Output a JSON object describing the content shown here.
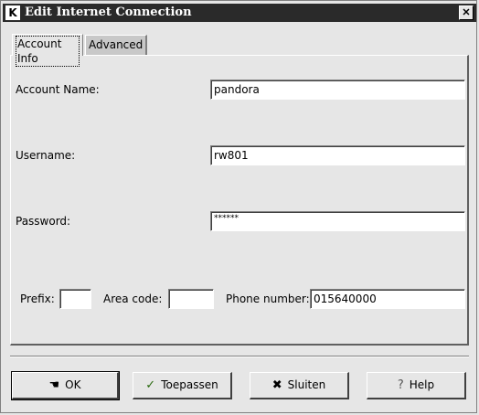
{
  "window": {
    "title": "Edit Internet Connection",
    "logo": "K",
    "close_glyph": "✕"
  },
  "tabs": [
    {
      "label": "Account Info",
      "active": true
    },
    {
      "label": "Advanced",
      "active": false
    }
  ],
  "form": {
    "account_name_label": "Account Name:",
    "account_name_value": "pandora",
    "username_label": "Username:",
    "username_value": "rw801",
    "password_label": "Password:",
    "password_value": "******",
    "prefix_label": "Prefix:",
    "prefix_value": "",
    "area_code_label": "Area code:",
    "area_code_value": "",
    "phone_label": "Phone number:",
    "phone_value": "015640000"
  },
  "buttons": {
    "ok": {
      "label": "OK",
      "icon": "hand-pointer-icon"
    },
    "apply": {
      "label": "Toepassen",
      "icon": "checkmark-icon"
    },
    "close": {
      "label": "Sluiten",
      "icon": "x-icon"
    },
    "help": {
      "label": "Help",
      "icon": "question-mark-icon"
    }
  }
}
